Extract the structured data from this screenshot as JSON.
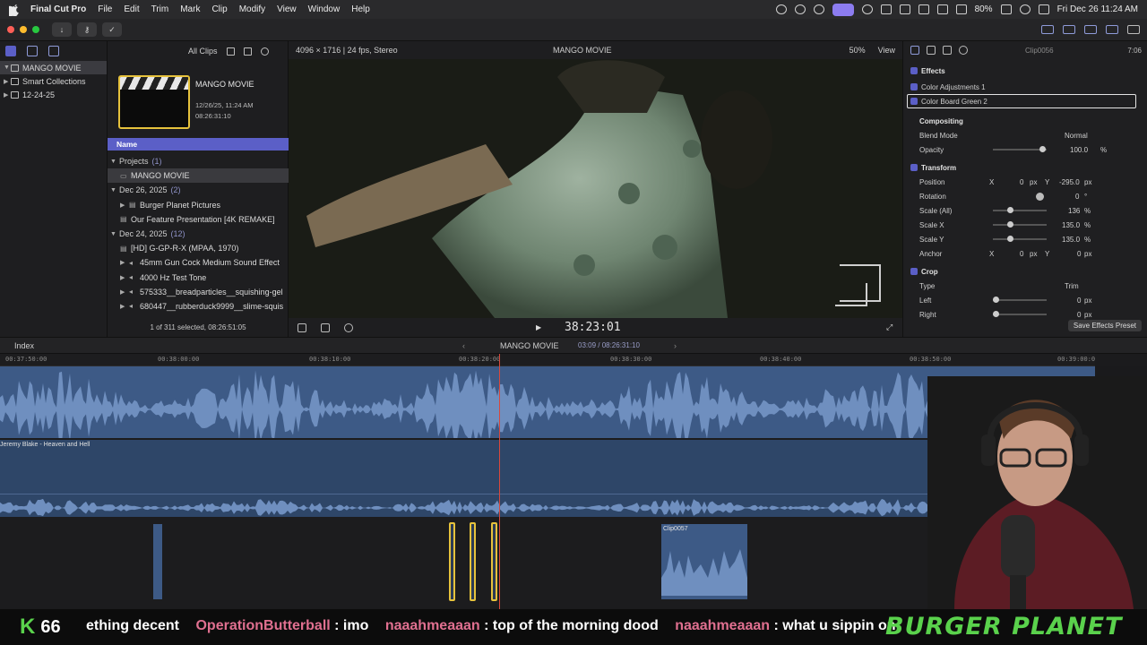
{
  "menubar": {
    "app_name": "Final Cut Pro",
    "menus": [
      "File",
      "Edit",
      "Trim",
      "Mark",
      "Clip",
      "Modify",
      "View",
      "Window",
      "Help"
    ],
    "battery": "80%",
    "datetime": "Fri Dec 26  11:24 AM"
  },
  "libraries": {
    "items": [
      {
        "label": "MANGO MOVIE",
        "selected": true,
        "expanded": true
      },
      {
        "label": "Smart Collections",
        "selected": false,
        "expanded": false
      },
      {
        "label": "12-24-25",
        "selected": false,
        "expanded": false
      }
    ]
  },
  "browser": {
    "filter_label": "All Clips",
    "card": {
      "title": "MANGO MOVIE",
      "date": "12/26/25, 11:24 AM",
      "duration": "08:26:31:10"
    },
    "name_header": "Name",
    "groups": [
      {
        "label": "Projects",
        "count": "(1)"
      },
      {
        "label": "Dec 26, 2025",
        "count": "(2)"
      },
      {
        "label": "Dec 24, 2025",
        "count": "(12)"
      }
    ],
    "project_item": "MANGO MOVIE",
    "dec26_items": [
      "Burger Planet Pictures",
      "Our Feature Presentation [4K REMAKE]"
    ],
    "dec24_items": [
      "[HD] G-GP-R-X (MPAA, 1970)",
      "45mm Gun Cock Medium Sound Effect",
      "4000 Hz Test Tone",
      "575333__breadparticles__squishing-gel",
      "680447__rubberduck9999__slime-squis"
    ],
    "footer": "1 of 311 selected, 08:26:51:05"
  },
  "viewer": {
    "format": "4096 × 1716 | 24 fps, Stereo",
    "title": "MANGO MOVIE",
    "zoom": "50%",
    "view_label": "View",
    "timecode": "38:23:01"
  },
  "inspector": {
    "clip_name": "Clip0056",
    "duration": "7:06",
    "effects_label": "Effects",
    "effect_1": "Color Adjustments 1",
    "effect_2": "Color Board Green 2",
    "compositing_label": "Compositing",
    "blend_mode_label": "Blend Mode",
    "blend_mode_value": "Normal",
    "opacity_label": "Opacity",
    "opacity_value": "100.0",
    "opacity_unit": "%",
    "transform_label": "Transform",
    "position_label": "Position",
    "position_x": "0",
    "position_y": "-295.0",
    "rotation_label": "Rotation",
    "rotation_value": "0",
    "scale_all_label": "Scale (All)",
    "scale_all_value": "136",
    "scale_x_label": "Scale X",
    "scale_x_value": "135.0",
    "scale_y_label": "Scale Y",
    "scale_y_value": "135.0",
    "anchor_label": "Anchor",
    "anchor_x": "0",
    "anchor_y": "0",
    "crop_label": "Crop",
    "type_label": "Type",
    "type_value": "Trim",
    "left_label": "Left",
    "left_value": "0",
    "right_label": "Right",
    "right_value": "0",
    "px_unit": "px",
    "x_label": "X",
    "y_label": "Y",
    "percent": "%",
    "degree": "°",
    "save_preset": "Save Effects Preset"
  },
  "timeline": {
    "index_label": "Index",
    "project_name": "MANGO MOVIE",
    "position": "03:09 / 08:26:31:10",
    "ruler": [
      "00:37:50:00",
      "00:38:00:00",
      "00:38:10:00",
      "00:38:20:00",
      "00:38:30:00",
      "00:38:40:00",
      "00:38:50:00",
      "00:39:00:0"
    ],
    "music_clip": "Jeremy Blake - Heaven and Hell",
    "connected_clip": "Clip0057"
  },
  "stream": {
    "logo": "K",
    "count": "66",
    "ticker": [
      {
        "user": "",
        "msg": "ething decent"
      },
      {
        "user": "OperationButterball",
        "msg": ": imo"
      },
      {
        "user": "naaahmeaaan",
        "msg": ": top of the morning dood"
      },
      {
        "user": "naaahmeaaan",
        "msg": ": what u sippin on"
      }
    ],
    "brand": "BURGER PLANET"
  },
  "colors": {
    "accent": "#5b5fc7",
    "selection_yellow": "#e6c23c",
    "audio_blue": "#3d5a86",
    "playhead": "#d8483c",
    "kick_green": "#5ad24c",
    "chat_user": "#e07090"
  }
}
